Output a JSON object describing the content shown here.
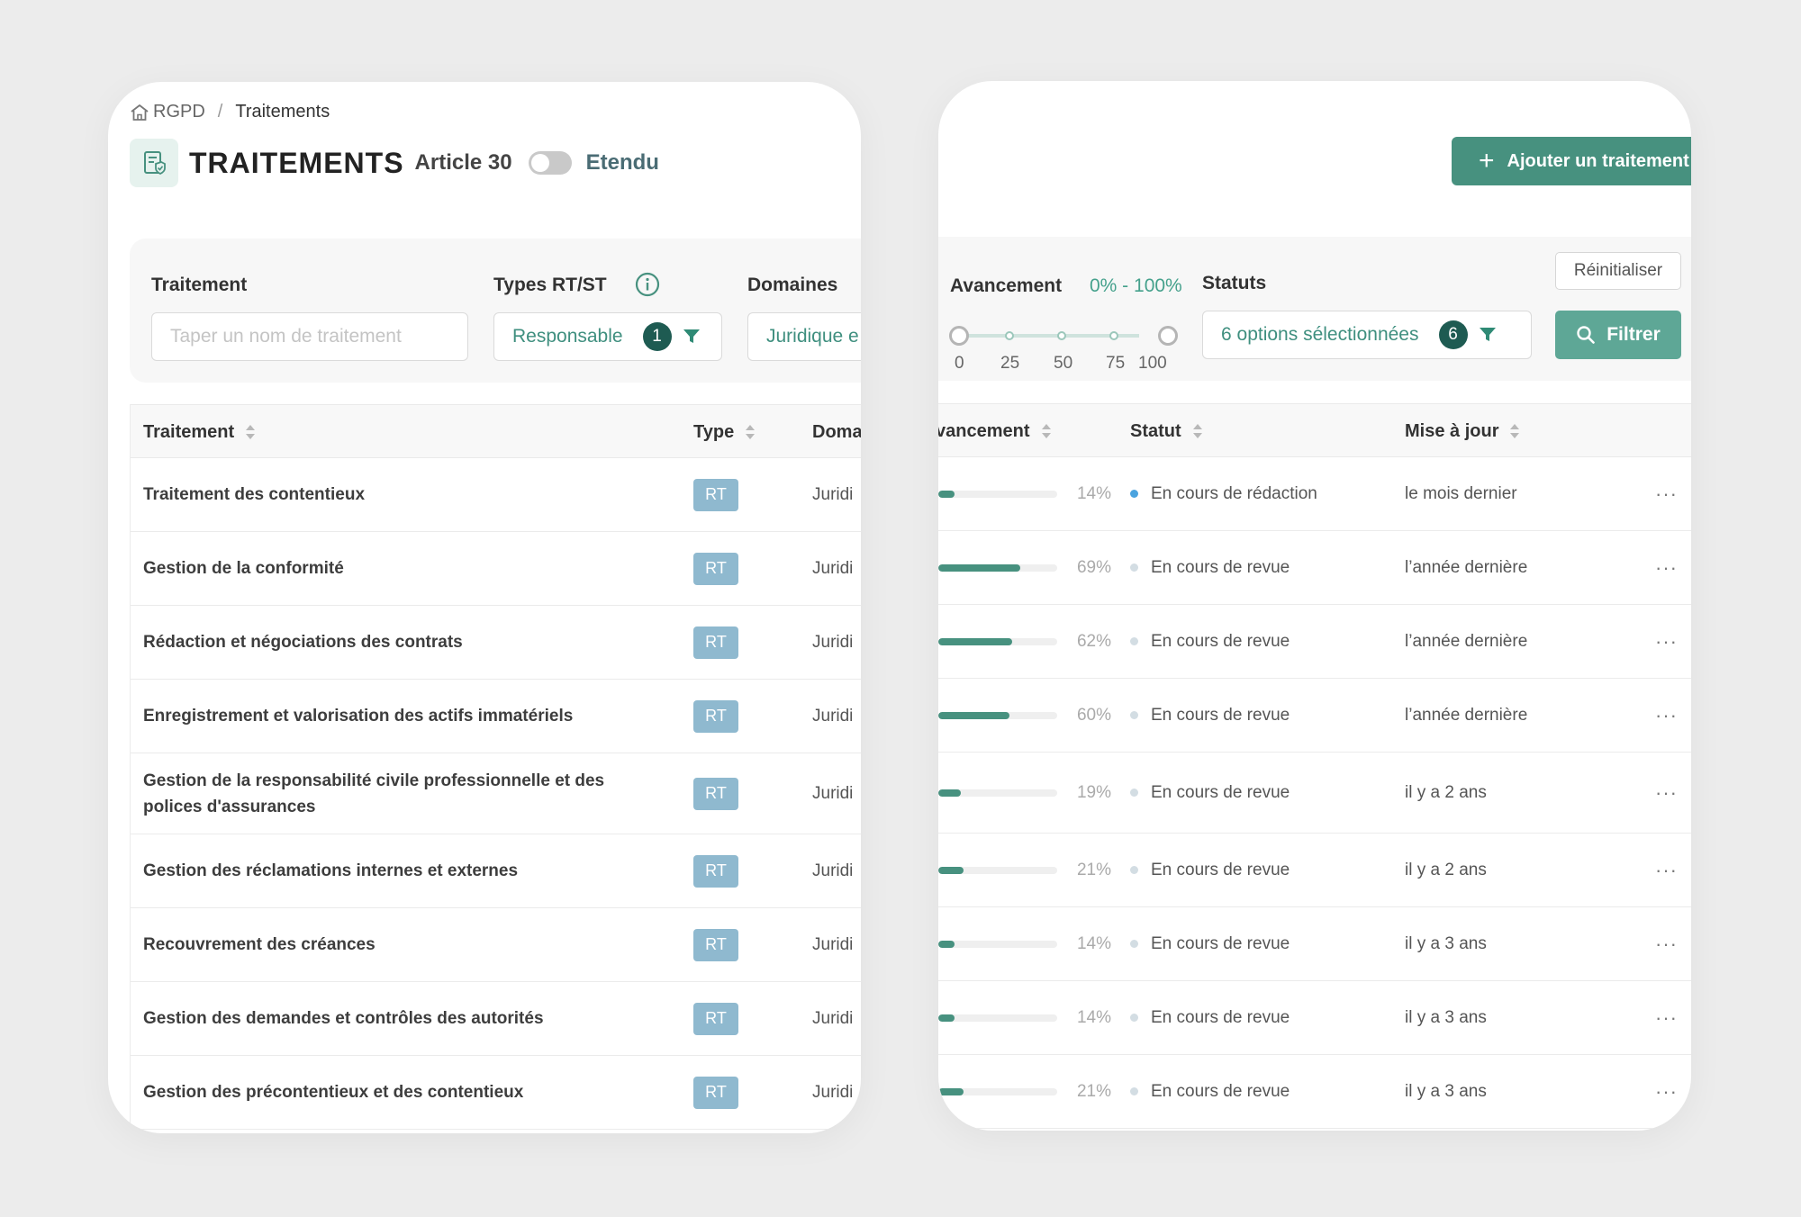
{
  "colors": {
    "accent": "#47917f",
    "badge_dark": "#1e5b52",
    "rt_badge": "#8fb9cf",
    "status_redaction": "#4aa3df",
    "status_revue": "#d3dde3",
    "progress_fill": "#47917f"
  },
  "breadcrumb": {
    "home_label": "RGPD",
    "separator": "/",
    "current": "Traitements"
  },
  "header": {
    "title": "TRAITEMENTS",
    "article_label": "Article 30",
    "toggle_label": "Etendu",
    "add_button_label": "Ajouter un traitement"
  },
  "filters": {
    "traitement": {
      "label": "Traitement",
      "placeholder": "Taper un nom de traitement"
    },
    "types": {
      "label": "Types RT/ST",
      "value": "Responsable",
      "count": "1"
    },
    "domaines": {
      "label": "Domaines",
      "value": "Juridique e"
    },
    "avancement": {
      "label": "Avancement",
      "range": "0% - 100%",
      "ticks": [
        "0",
        "25",
        "50",
        "75",
        "100"
      ],
      "min": 0,
      "max": 100
    },
    "statuts": {
      "label": "Statuts",
      "value": "6 options sélectionnées",
      "count": "6"
    },
    "reset_label": "Réinitialiser",
    "filter_label": "Filtrer"
  },
  "table": {
    "columns": {
      "traitement": "Traitement",
      "type": "Type",
      "domaine": "Doma",
      "avancement": "vancement",
      "statut": "Statut",
      "maj": "Mise à jour"
    },
    "rows": [
      {
        "name": "Traitement des contentieux",
        "type": "RT",
        "domain": "Juridi",
        "progress": 14,
        "progress_label": "14%",
        "status": "En cours de rédaction",
        "status_kind": "redaction",
        "updated": "le mois dernier",
        "more": "···"
      },
      {
        "name": "Gestion de la conformité",
        "type": "RT",
        "domain": "Juridi",
        "progress": 69,
        "progress_label": "69%",
        "status": "En cours de revue",
        "status_kind": "revue",
        "updated": "l’année dernière",
        "more": "···"
      },
      {
        "name": "Rédaction et négociations des contrats",
        "type": "RT",
        "domain": "Juridi",
        "progress": 62,
        "progress_label": "62%",
        "status": "En cours de revue",
        "status_kind": "revue",
        "updated": "l’année dernière",
        "more": "···"
      },
      {
        "name": "Enregistrement et valorisation des actifs immatériels",
        "type": "RT",
        "domain": "Juridi",
        "progress": 60,
        "progress_label": "60%",
        "status": "En cours de revue",
        "status_kind": "revue",
        "updated": "l’année dernière",
        "more": "···"
      },
      {
        "name": "Gestion de la responsabilité civile professionnelle et des polices d'assurances",
        "type": "RT",
        "domain": "Juridi",
        "progress": 19,
        "progress_label": "19%",
        "status": "En cours de revue",
        "status_kind": "revue",
        "updated": "il y a 2 ans",
        "more": "···"
      },
      {
        "name": "Gestion des réclamations internes et externes",
        "type": "RT",
        "domain": "Juridi",
        "progress": 21,
        "progress_label": "21%",
        "status": "En cours de revue",
        "status_kind": "revue",
        "updated": "il y a 2 ans",
        "more": "···"
      },
      {
        "name": "Recouvrement des créances",
        "type": "RT",
        "domain": "Juridi",
        "progress": 14,
        "progress_label": "14%",
        "status": "En cours de revue",
        "status_kind": "revue",
        "updated": "il y a 3 ans",
        "more": "···"
      },
      {
        "name": "Gestion des demandes et contrôles des autorités",
        "type": "RT",
        "domain": "Juridi",
        "progress": 14,
        "progress_label": "14%",
        "status": "En cours de revue",
        "status_kind": "revue",
        "updated": "il y a 3 ans",
        "more": "···"
      },
      {
        "name": "Gestion des précontentieux et des contentieux",
        "type": "RT",
        "domain": "Juridi",
        "progress": 21,
        "progress_label": "21%",
        "status": "En cours de revue",
        "status_kind": "revue",
        "updated": "il y a 3 ans",
        "more": "···"
      }
    ]
  }
}
